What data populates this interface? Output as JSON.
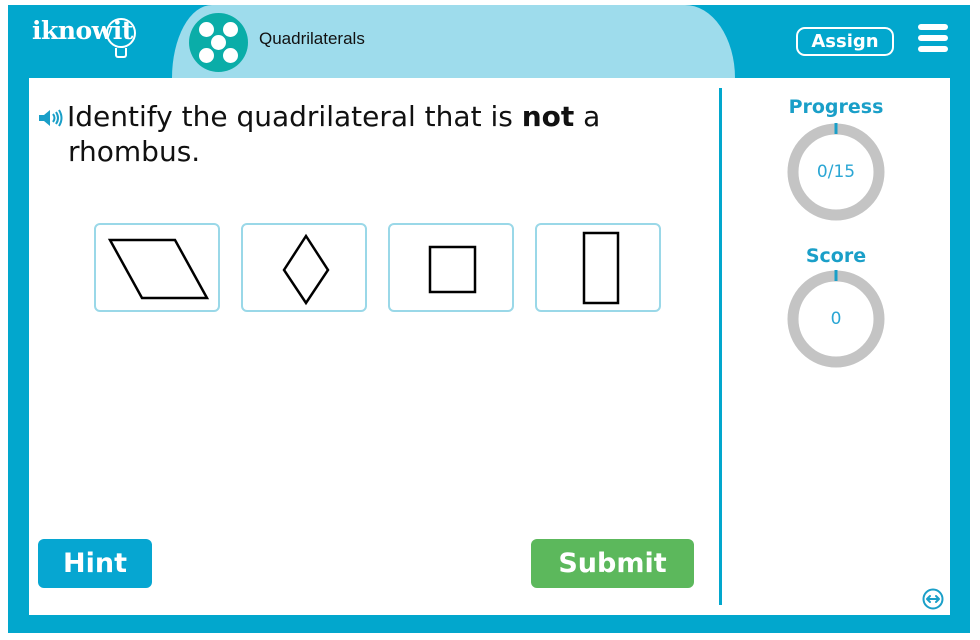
{
  "header": {
    "logo_text": "iknowit",
    "topic_title": "Quadrilaterals",
    "topic_icon": "five-dots-icon",
    "assign_label": "Assign",
    "menu_icon": "hamburger-menu-icon"
  },
  "question": {
    "speaker_icon": "speaker-icon",
    "text_before": "Identify the quadrilateral that is ",
    "text_bold": "not",
    "text_after": " a",
    "text_line2": "rhombus."
  },
  "choices": [
    {
      "id": "parallelogram",
      "shape": "parallelogram"
    },
    {
      "id": "rhombus",
      "shape": "rhombus"
    },
    {
      "id": "square",
      "shape": "square"
    },
    {
      "id": "rectangle",
      "shape": "rectangle"
    }
  ],
  "sidebar": {
    "progress_label": "Progress",
    "progress_value": "0/15",
    "progress_fraction": 0,
    "score_label": "Score",
    "score_value": "0",
    "score_fraction": 0
  },
  "buttons": {
    "hint_label": "Hint",
    "submit_label": "Submit"
  },
  "colors": {
    "brand": "#02a7cd",
    "topic_tab": "#9edcec",
    "submit": "#5cb85c",
    "ring_track": "#c4c4c4"
  }
}
